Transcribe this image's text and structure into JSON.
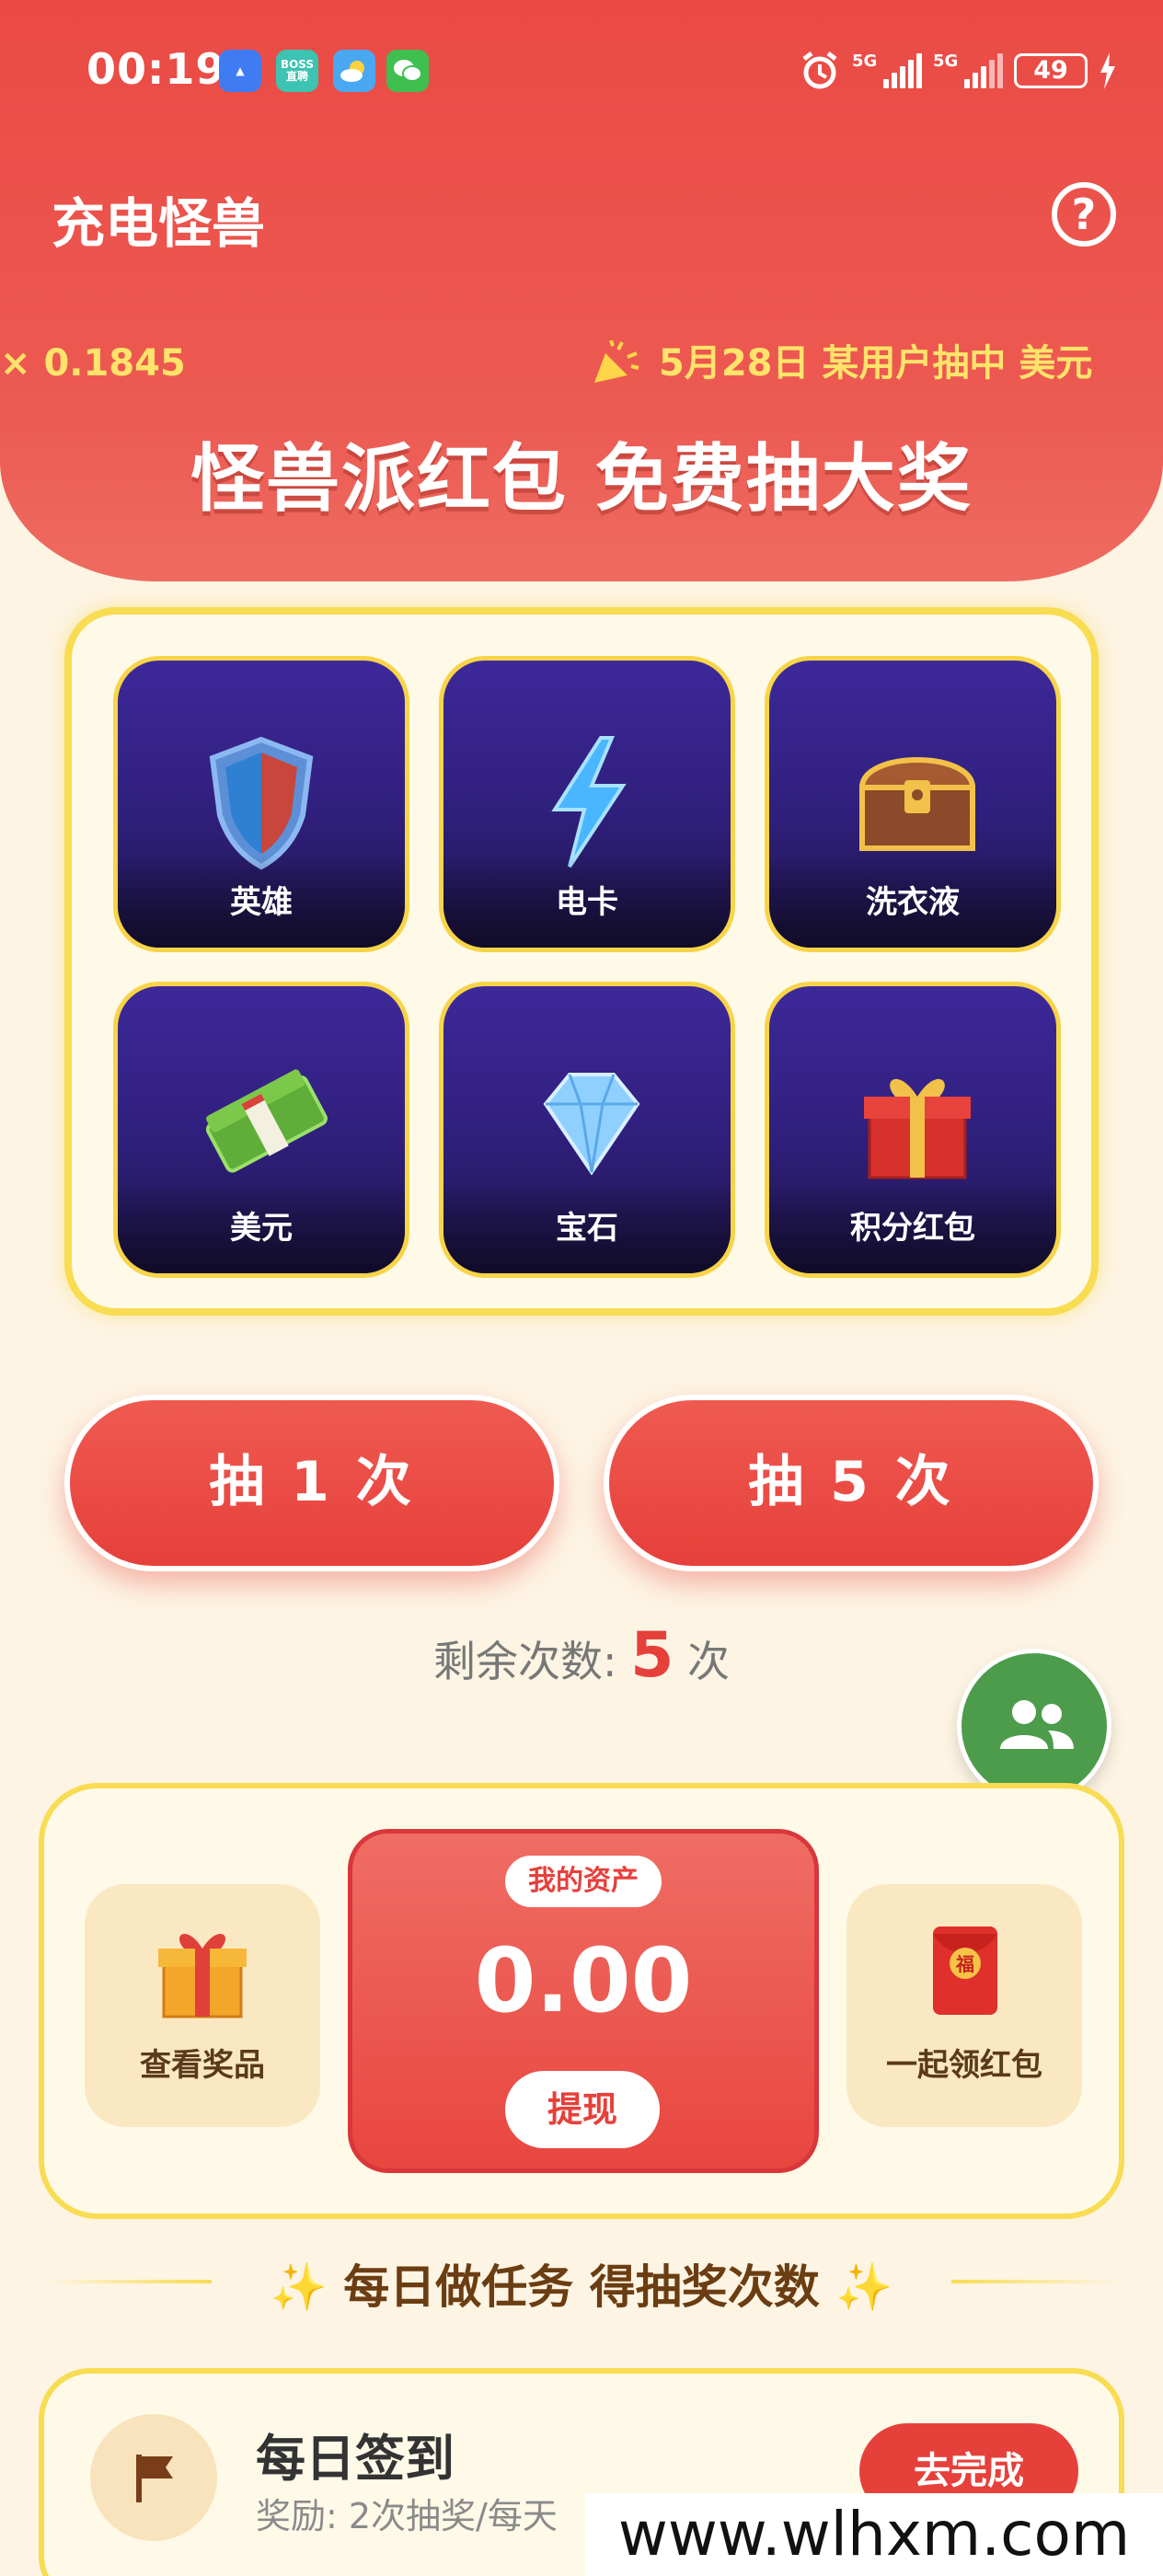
{
  "status_bar": {
    "time": "00:19",
    "apps": [
      {
        "name": "App Market",
        "color": "#3f7cf4"
      },
      {
        "name": "BOSS 直聘",
        "color": "#3cc3b1"
      },
      {
        "name": "weather",
        "color": "#4aa8f0"
      },
      {
        "name": "WeChat",
        "color": "#3fbf50"
      }
    ],
    "battery": "49",
    "network1": "5G",
    "network2": "5G"
  },
  "header": {
    "title": "充电怪兽",
    "ticker_left": "× 0.1845",
    "ticker_right": "5月28日 某用户抽中 美元",
    "banner": "怪兽派红包 免费抽大奖"
  },
  "prizes": [
    {
      "label": "英雄",
      "icon": "shield-icon"
    },
    {
      "label": "电卡",
      "icon": "lightning-icon"
    },
    {
      "label": "洗衣液",
      "icon": "treasure-chest-icon"
    },
    {
      "label": "美元",
      "icon": "cash-icon"
    },
    {
      "label": "宝石",
      "icon": "diamond-icon"
    },
    {
      "label": "积分红包",
      "icon": "gift-box-icon"
    }
  ],
  "draw": {
    "once_label": "抽 1 次",
    "five_label": "抽 5 次",
    "remain_prefix": "剩余次数:",
    "remain_count": "5",
    "remain_suffix": "次"
  },
  "assets": {
    "view_prizes_label": "查看奖品",
    "my_assets_label": "我的资产",
    "amount": "0.00",
    "withdraw_label": "提现",
    "group_redpacket_label": "一起领红包"
  },
  "tasks": {
    "section_title": "✨ 每日做任务 得抽奖次数 ✨",
    "items": [
      {
        "title": "每日签到",
        "reward": "奖励: 2次抽奖/每天",
        "button": "去完成"
      }
    ]
  },
  "watermark": "www.wlhxm.com",
  "colors": {
    "primary_red": "#e6403b",
    "gold_border": "#f8dc52",
    "card_purple": "#2f1f7b",
    "fab_green": "#4d9c4c"
  }
}
